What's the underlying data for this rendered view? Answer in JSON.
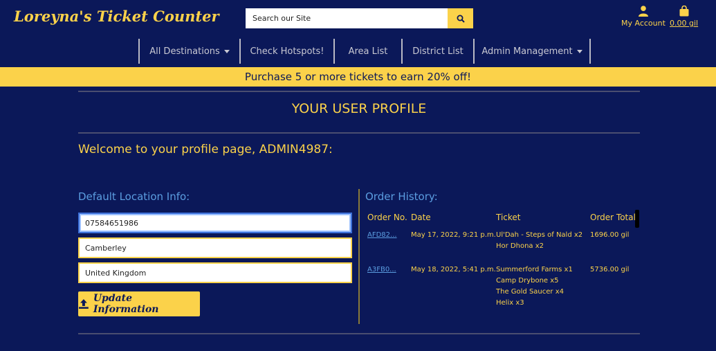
{
  "header": {
    "brand": "Loreyna's Ticket Counter",
    "search_placeholder": "Search our Site",
    "account_label": "My Account",
    "cart_label": "0.00 gil"
  },
  "nav": {
    "items": [
      {
        "label": "All Destinations",
        "has_caret": true
      },
      {
        "label": "Check Hotspots!",
        "has_caret": false
      },
      {
        "label": "Area List",
        "has_caret": false
      },
      {
        "label": "District List",
        "has_caret": false
      },
      {
        "label": "Admin Management",
        "has_caret": true
      }
    ]
  },
  "promo": "Purchase 5 or more tickets to earn 20% off!",
  "profile": {
    "title": "YOUR USER PROFILE",
    "welcome": "Welcome to your profile page, ADMIN4987:",
    "location_heading": "Default Location Info:",
    "fields": [
      "07584651986",
      "Camberley",
      "United Kingdom"
    ],
    "update_label": "Update Information"
  },
  "orders": {
    "heading": "Order History:",
    "columns": [
      "Order No.",
      "Date",
      "Ticket",
      "Order Total"
    ],
    "rows": [
      {
        "order_no": "AFD82...",
        "date": "May 17, 2022, 9:21 p.m.",
        "tickets": [
          "Ul'Dah - Steps of Nald x2",
          "Hor Dhona x2"
        ],
        "total": "1696.00 gil"
      },
      {
        "order_no": "A3FB0...",
        "date": "May 18, 2022, 5:41 p.m.",
        "tickets": [
          "Summerford Farms x1",
          "Camp Drybone x5",
          "The Gold Saucer x4",
          "Helix x3"
        ],
        "total": "5736.00 gil"
      }
    ]
  },
  "colors": {
    "background": "#0b1859",
    "accent": "#fbd24a",
    "link": "#5b9de0"
  }
}
